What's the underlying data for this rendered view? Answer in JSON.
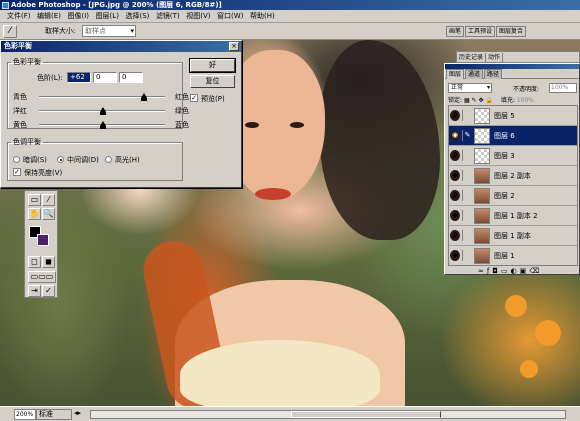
{
  "window": {
    "title": "Adobe Photoshop - [JPG.jpg @ 200% (图层 6, RGB/8#)]"
  },
  "menu": [
    "文件(F)",
    "编辑(E)",
    "图像(I)",
    "图层(L)",
    "选择(S)",
    "滤镜(T)",
    "视图(V)",
    "窗口(W)",
    "帮助(H)"
  ],
  "options": {
    "tool_icon": "eyedropper-icon",
    "sample_label": "取样大小:",
    "sample_value": "取样点",
    "tabs": [
      "画笔",
      "工具预设",
      "图层复合"
    ]
  },
  "dialog": {
    "title": "色彩平衡",
    "close": "×",
    "balance_group": "色彩平衡",
    "levels_label": "色阶(L):",
    "levels": [
      "+62",
      "0",
      "0"
    ],
    "sliders": [
      {
        "left": "青色",
        "right": "红色",
        "value": 62
      },
      {
        "left": "洋红",
        "right": "绿色",
        "value": 0
      },
      {
        "left": "黄色",
        "right": "蓝色",
        "value": 0
      }
    ],
    "ok": "好",
    "reset": "复位",
    "preview": "预览(P)",
    "tone_group": "色调平衡",
    "tone_options": [
      "暗调(S)",
      "中间调(D)",
      "高光(H)"
    ],
    "tone_selected": 1,
    "preserve": "保持亮度(V)"
  },
  "palette": {
    "top_tabs": [
      "历史记录",
      "动作"
    ],
    "tabs": [
      "图层",
      "通道",
      "路径"
    ],
    "blend_mode": "正常",
    "opacity_label": "不透明度:",
    "opacity_value": "100%",
    "lock_label": "锁定:",
    "fill_label": "填充:",
    "fill_value": "100%",
    "layers": [
      {
        "name": "图层 5",
        "thumb": "checker"
      },
      {
        "name": "图层 6",
        "thumb": "checker",
        "selected": true
      },
      {
        "name": "图层 3",
        "thumb": "checker"
      },
      {
        "name": "图层 2 副本",
        "thumb": "photo"
      },
      {
        "name": "图层 2",
        "thumb": "photo"
      },
      {
        "name": "图层 1 副本 2",
        "thumb": "photo"
      },
      {
        "name": "图层 1 副本",
        "thumb": "photo"
      },
      {
        "name": "图层 1",
        "thumb": "photo"
      }
    ]
  },
  "status": {
    "zoom": "200%",
    "mode": "标准"
  },
  "colors": {
    "accent": "#0a246a",
    "foreground_swatch": "#000000",
    "background_swatch": "#4a1f6a"
  }
}
